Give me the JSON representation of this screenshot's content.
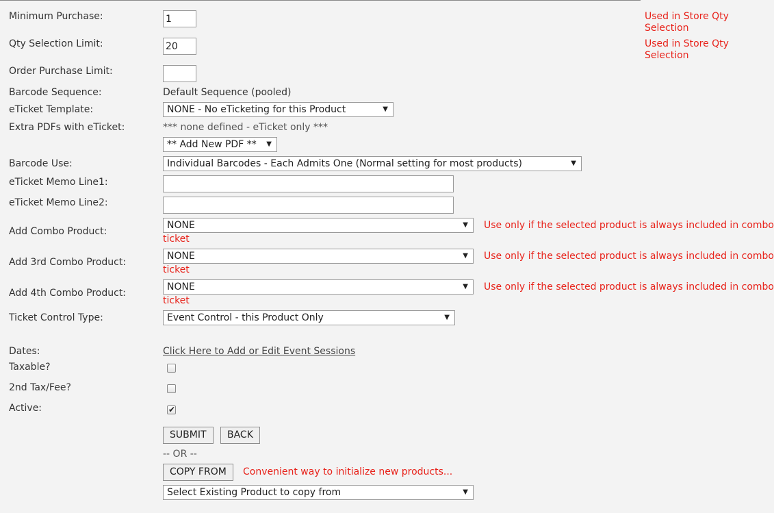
{
  "fields": {
    "minimum_purchase": {
      "label": "Minimum Purchase:",
      "value": "1",
      "note": "Used in Store Qty Selection"
    },
    "qty_selection_limit": {
      "label": "Qty Selection Limit:",
      "value": "20",
      "note": "Used in Store Qty Selection"
    },
    "order_purchase_limit": {
      "label": "Order Purchase Limit:",
      "value": ""
    },
    "barcode_sequence": {
      "label": "Barcode Sequence:",
      "value": "Default Sequence (pooled)"
    },
    "eticket_template": {
      "label": "eTicket Template:",
      "value": "NONE - No eTicketing for this Product"
    },
    "extra_pdfs": {
      "label": "Extra PDFs with eTicket:",
      "value": "*** none defined - eTicket only ***",
      "add_option": "** Add New PDF **"
    },
    "barcode_use": {
      "label": "Barcode Use:",
      "value": "Individual Barcodes - Each Admits One (Normal setting for most products)"
    },
    "memo_line1": {
      "label": "eTicket Memo Line1:",
      "value": ""
    },
    "memo_line2": {
      "label": "eTicket Memo Line2:",
      "value": ""
    },
    "combo_product": {
      "label": "Add Combo Product:",
      "value": "NONE",
      "note_line1": "Use only if the selected product is always included in combo",
      "note_line2": "ticket"
    },
    "combo_product_3": {
      "label": "Add 3rd Combo Product:",
      "value": "NONE",
      "note_line1": "Use only if the selected product is always included in combo",
      "note_line2": "ticket"
    },
    "combo_product_4": {
      "label": "Add 4th Combo Product:",
      "value": "NONE",
      "note_line1": "Use only if the selected product is always included in combo",
      "note_line2": "ticket"
    },
    "ticket_control_type": {
      "label": "Ticket Control Type:",
      "value": "Event Control - this Product Only"
    },
    "dates": {
      "label": "Dates:",
      "link": "Click Here to Add or Edit Event Sessions"
    },
    "taxable": {
      "label": "Taxable?",
      "checked": false
    },
    "second_tax": {
      "label": "2nd Tax/Fee?",
      "checked": false
    },
    "active": {
      "label": "Active:",
      "checked": true
    }
  },
  "actions": {
    "submit_label": "SUBMIT",
    "back_label": "BACK",
    "or_text": "-- OR --",
    "copy_from_label": "COPY FROM",
    "copy_note": "Convenient way to initialize new products...",
    "copy_select_value": "Select Existing Product to copy from"
  },
  "colors": {
    "background": "#f3f3f3",
    "note_red": "#e8231b",
    "text": "#333333"
  },
  "icons": {
    "dropdown": "chevron-down-icon",
    "check": "check-icon"
  }
}
